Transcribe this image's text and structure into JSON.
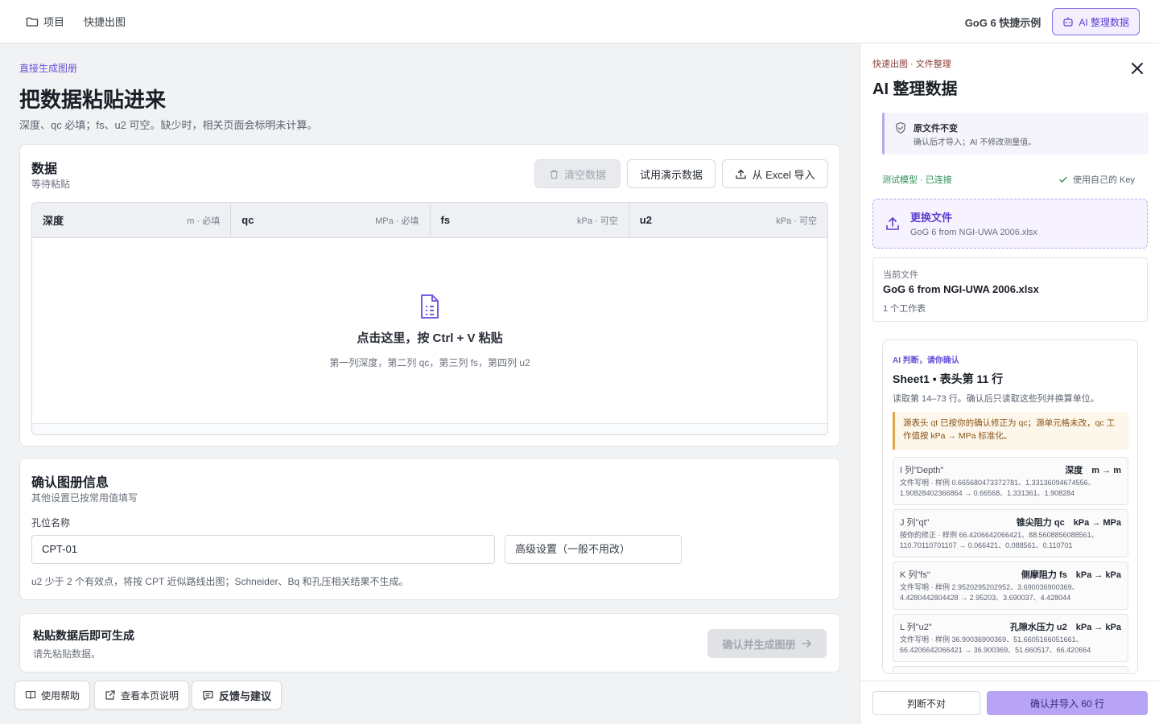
{
  "topbar": {
    "project_label": "项目",
    "quick_label": "快捷出图",
    "example_label": "GoG 6 快捷示例",
    "ai_button_label": "AI 整理数据"
  },
  "main": {
    "breadcrumb": "直接生成图册",
    "title": "把数据粘贴进来",
    "subtitle": "深度、qc 必填；fs、u2 可空。缺少时，相关页面会标明未计算。",
    "data_card": {
      "title": "数据",
      "status": "等待粘贴",
      "clear_label": "清空数据",
      "demo_label": "试用演示数据",
      "import_label": "从 Excel 导入",
      "columns": [
        {
          "name": "深度",
          "unit": "m · 必填"
        },
        {
          "name": "qc",
          "unit": "MPa · 必填"
        },
        {
          "name": "fs",
          "unit": "kPa · 可空"
        },
        {
          "name": "u2",
          "unit": "kPa · 可空"
        }
      ],
      "paste_title": "点击这里，按 Ctrl + V 粘贴",
      "paste_hint": "第一列深度，第二列 qc，第三列 fs，第四列 u2"
    },
    "info_card": {
      "title": "确认图册信息",
      "subtitle": "其他设置已按常用值填写",
      "hole_label": "孔位名称",
      "hole_value": "CPT-01",
      "advanced_label": "高级设置（一般不用改）",
      "note": "u2 少于 2 个有效点，将按 CPT 近似路线出图；Schneider、Bq 和孔压相关结果不生成。"
    },
    "gen_card": {
      "title": "粘贴数据后即可生成",
      "subtitle": "请先粘贴数据。",
      "button_label": "确认并生成图册"
    },
    "footer": {
      "help_label": "使用帮助",
      "page_doc_label": "查看本页说明",
      "feedback_label": "反馈与建议"
    }
  },
  "panel": {
    "breadcrumb": "快速出图 · 文件整理",
    "title": "AI 整理数据",
    "notice_title": "原文件不变",
    "notice_sub": "确认后才导入；AI 不修改测量值。",
    "model_status": "测试模型 · 已连接",
    "own_key_label": "使用自己的 Key",
    "replace_title": "更换文件",
    "replace_file": "GoG 6 from NGI-UWA 2006.xlsx",
    "current_label": "当前文件",
    "current_name": "GoG 6 from NGI-UWA 2006.xlsx",
    "sheet_count": "1 个工作表",
    "ai": {
      "label": "AI 判断，请你确认",
      "title": "Sheet1 • 表头第 11 行",
      "subtitle": "读取第 14–73 行。确认后只读取这些列并换算单位。",
      "note": "源表头 qt 已按你的确认修正为 qc；源单元格未改，qc 工作值按 kPa → MPa 标准化。",
      "mappings": [
        {
          "source": "I 列\"Depth\"",
          "target": "深度　m → m",
          "detail": "文件写明 · 样例 0.665680473372781、1.33136094674556、1.90828402366864 → 0.66568、1.331361、1.908284"
        },
        {
          "source": "J 列\"qt\"",
          "target": "锥尖阻力 qc　kPa → MPa",
          "detail": "按你的修正 · 样例 66.4206642066421、88.5608856088561、110.70110701107 → 0.066421、0.088561、0.110701"
        },
        {
          "source": "K 列\"fs\"",
          "target": "侧摩阻力 fs　kPa → kPa",
          "detail": "文件写明 · 样例 2.9520295202952、3.690036900369、4.4280442804428 → 2.95203、3.690037、4.428044"
        },
        {
          "source": "L 列\"u2\"",
          "target": "孔隙水压力 u2　kPa → kPa",
          "detail": "文件写明 · 样例 36.90036900369、51.6605166051661、66.4206642066421 → 36.900369、51.660517、66.420664"
        }
      ]
    },
    "reject_label": "判断不对",
    "confirm_label": "确认并导入 60 行"
  }
}
